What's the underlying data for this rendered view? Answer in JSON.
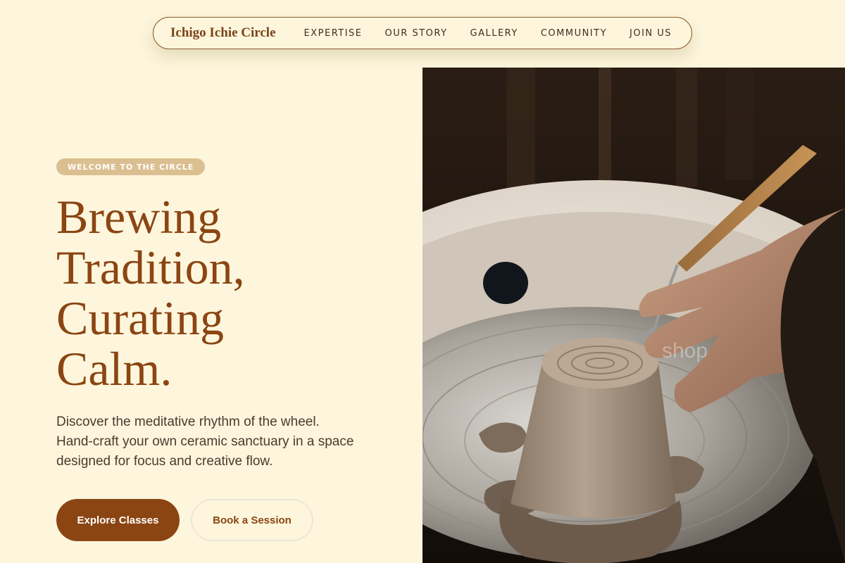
{
  "nav": {
    "brand": "Ichigo Ichie Circle",
    "links": [
      "EXPERTISE",
      "OUR STORY",
      "GALLERY",
      "COMMUNITY",
      "JOIN US"
    ]
  },
  "hero": {
    "badge": "WELCOME TO THE CIRCLE",
    "headline": [
      "Brewing",
      "Tradition,",
      "Curating",
      "Calm."
    ],
    "intro": [
      "Discover the meditative rhythm of the wheel.",
      "Hand-craft your own ceramic sanctuary in a space",
      "designed for focus and creative flow."
    ],
    "primary_button": "Explore Classes",
    "secondary_button": "Book a Session",
    "image_watermark": "shop"
  },
  "colors": {
    "background": "#fdf6dc",
    "accent": "#8b4513",
    "badge": "#dcbf91",
    "text": "#4a3b30"
  }
}
